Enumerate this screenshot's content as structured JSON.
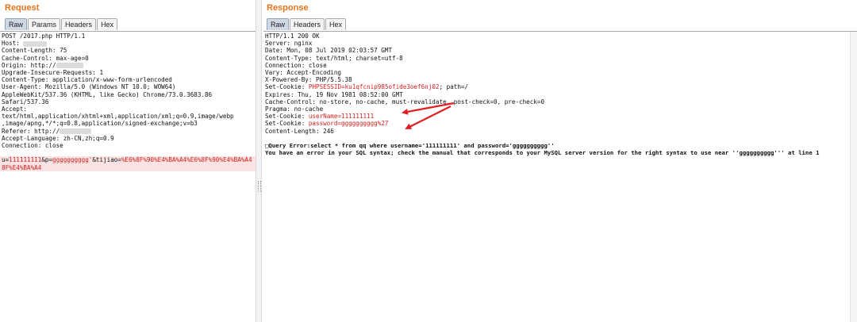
{
  "request": {
    "title": "Request",
    "tabs": [
      {
        "label": "Raw",
        "active": true
      },
      {
        "label": "Params",
        "active": false
      },
      {
        "label": "Headers",
        "active": false
      },
      {
        "label": "Hex",
        "active": false
      }
    ],
    "lines": [
      "POST /2017.php HTTP/1.1",
      "Host: ",
      "Content-Length: 75",
      "Cache-Control: max-age=0",
      "Origin: http://",
      "Upgrade-Insecure-Requests: 1",
      "Content-Type: application/x-www-form-urlencoded",
      "User-Agent: Mozilla/5.0 (Windows NT 10.0; WOW64)",
      "AppleWebKit/537.36 (KHTML, like Gecko) Chrome/73.0.3683.86",
      "Safari/537.36",
      "Accept:",
      "text/html,application/xhtml+xml,application/xml;q=0.9,image/webp",
      ",image/apng,*/*;q=0.8,application/signed-exchange;v=b3",
      "Referer: http://",
      "Accept-Language: zh-CN,zh;q=0.9",
      "Connection: close"
    ],
    "body": {
      "u_key": "u",
      "u_value": "111111111",
      "p_key": "p",
      "p_value": "gggggggggg'",
      "tj_key": "tijiao",
      "tj_value_1": "%E6%8F%90%E4%BA%A4%E6%8F%90%E4%BA%A4",
      "tj_value_2": "8F%E4%BA%A4"
    }
  },
  "response": {
    "title": "Response",
    "tabs": [
      {
        "label": "Raw",
        "active": true
      },
      {
        "label": "Headers",
        "active": false
      },
      {
        "label": "Hex",
        "active": false
      }
    ],
    "lines": [
      "HTTP/1.1 200 OK",
      "Server: nginx",
      "Date: Mon, 08 Jul 2019 02:03:57 GMT",
      "Content-Type: text/html; charset=utf-8",
      "Connection: close",
      "Vary: Accept-Encoding",
      "X-Powered-By: PHP/5.5.38"
    ],
    "session_cookie_prefix": "Set-Cookie: ",
    "session_cookie_name": "PHPSESSID",
    "session_cookie_value": "=ku1qfcnip985ofide3oef6nj02",
    "session_cookie_suffix": "; path=/",
    "lines2": [
      "Expires: Thu, 19 Nov 1981 08:52:00 GMT",
      "Cache-Control: no-store, no-cache, must-revalidate, post-check=0, pre-check=0",
      "Pragma: no-cache"
    ],
    "user_cookie_prefix": "Set-Cookie: ",
    "user_cookie_name": "userName",
    "user_cookie_value": "=111111111",
    "pass_cookie_prefix": "Set-Cookie: ",
    "pass_cookie_name": "password",
    "pass_cookie_value": "=gggggggggg%27",
    "content_length": "Content-Length: 246",
    "error_line_1": "□Query Error:select * from qq where username='111111111' and password='gggggggggg''",
    "error_line_2": "You have an error in your SQL syntax; check the manual that corresponds to your MySQL server version for the right syntax to use near ''gggggggggg''' at line 1"
  },
  "colors": {
    "title_orange": "#e8731a",
    "highlight_red": "#d02020",
    "arrow_red": "#e02020"
  }
}
